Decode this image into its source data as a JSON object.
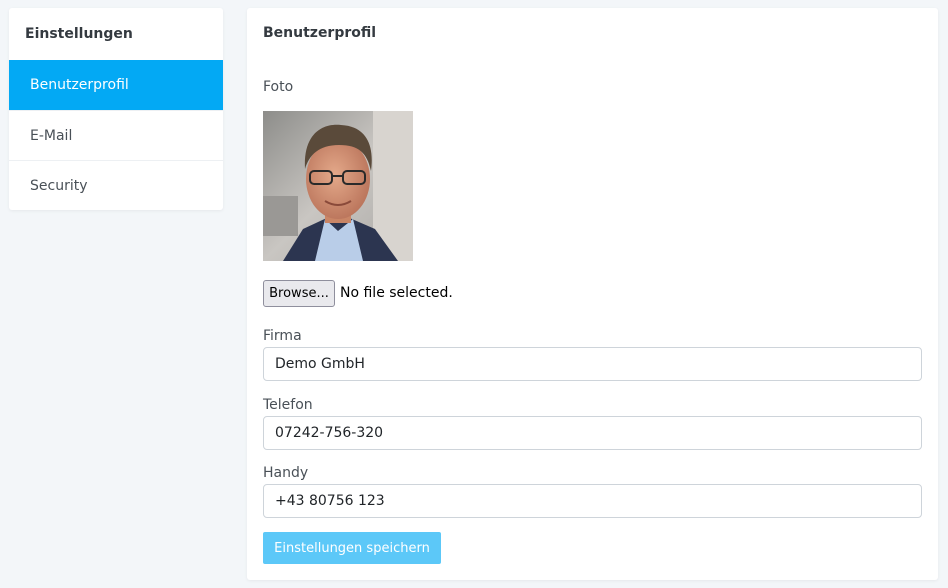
{
  "sidebar": {
    "title": "Einstellungen",
    "items": [
      {
        "label": "Benutzerprofil",
        "active": true
      },
      {
        "label": "E-Mail",
        "active": false
      },
      {
        "label": "Security",
        "active": false
      }
    ]
  },
  "main": {
    "title": "Benutzerprofil",
    "photo_label": "Foto",
    "browse_label": "Browse...",
    "file_status": "No file selected.",
    "fields": {
      "firma": {
        "label": "Firma",
        "value": "Demo GmbH"
      },
      "telefon": {
        "label": "Telefon",
        "value": "07242-756-320"
      },
      "handy": {
        "label": "Handy",
        "value": "+43 80756 123"
      }
    },
    "save_label": "Einstellungen speichern"
  },
  "colors": {
    "accent": "#03a9f4",
    "save_button": "#5cc8f8",
    "background": "#f3f6f9"
  }
}
